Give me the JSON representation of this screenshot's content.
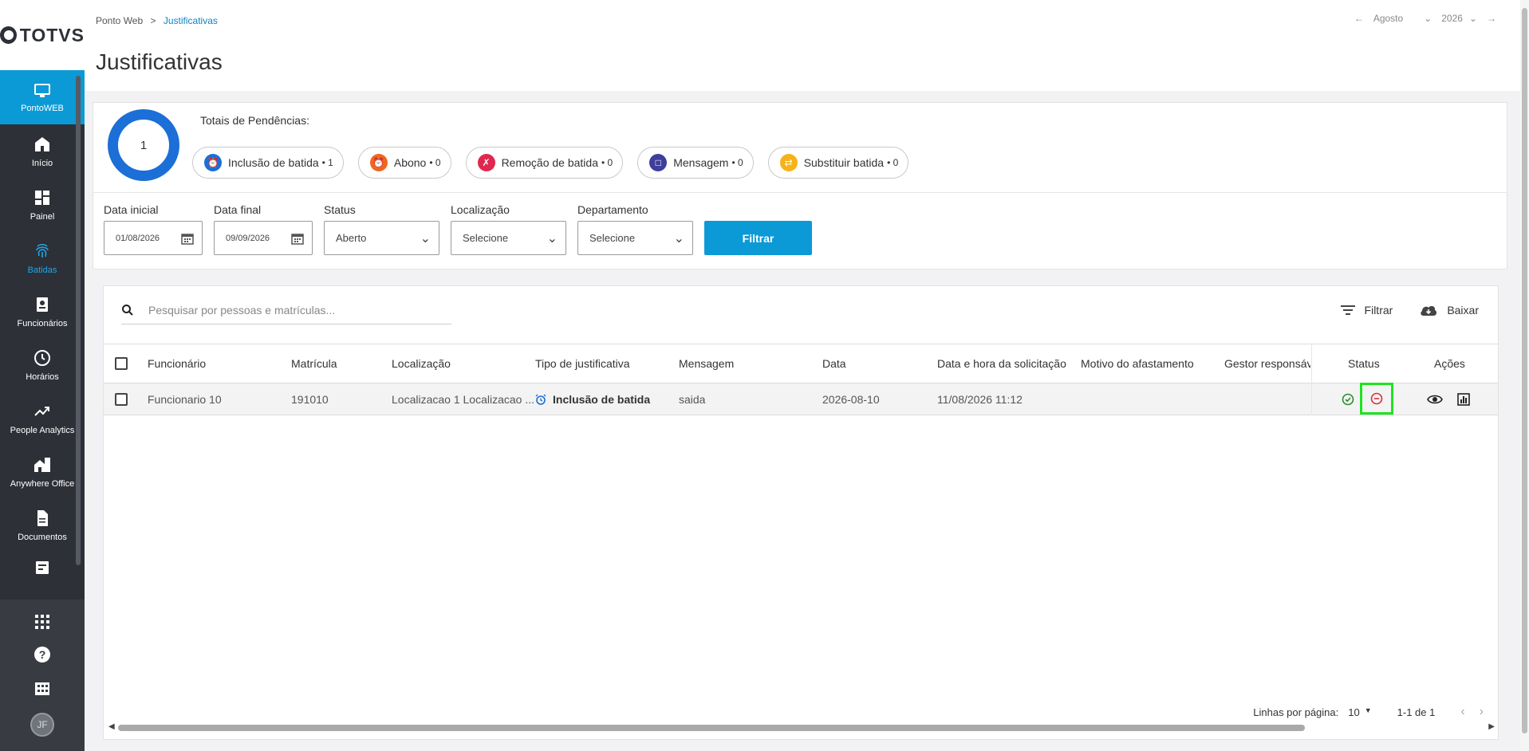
{
  "brand": {
    "name": "TOTVS"
  },
  "sidebar": {
    "active": {
      "label": "PontoWEB"
    },
    "items": [
      {
        "label": "Início",
        "icon": "home-icon"
      },
      {
        "label": "Painel",
        "icon": "dashboard-icon"
      },
      {
        "label": "Batidas",
        "icon": "fingerprint-icon"
      },
      {
        "label": "Funcionários",
        "icon": "badge-icon"
      },
      {
        "label": "Horários",
        "icon": "clock-icon"
      },
      {
        "label": "People Analytics",
        "icon": "trend-icon"
      },
      {
        "label": "Anywhere Office",
        "icon": "office-icon"
      },
      {
        "label": "Documentos",
        "icon": "document-icon"
      }
    ],
    "avatar_initials": "JF"
  },
  "header": {
    "breadcrumb": {
      "root": "Ponto Web",
      "separator": ">",
      "current": "Justificativas"
    },
    "title": "Justificativas",
    "period": {
      "month": "Agosto",
      "year": "2026"
    }
  },
  "summary": {
    "total": "1",
    "label": "Totais de Pendências:",
    "chips": [
      {
        "label": "Inclusão de batida",
        "count": "• 1",
        "color": "#1b6fd6"
      },
      {
        "label": "Abono",
        "count": "• 0",
        "color": "#f0651f"
      },
      {
        "label": "Remoção de batida",
        "count": "• 0",
        "color": "#e0274f"
      },
      {
        "label": "Mensagem",
        "count": "• 0",
        "color": "#3e3f9a"
      },
      {
        "label": "Substituir batida",
        "count": "• 0",
        "color": "#f6b21a"
      }
    ]
  },
  "filters": {
    "data_inicial": {
      "label": "Data inicial",
      "value": "01/08/2026"
    },
    "data_final": {
      "label": "Data final",
      "value": "09/09/2026"
    },
    "status": {
      "label": "Status",
      "value": "Aberto"
    },
    "localizacao": {
      "label": "Localização",
      "value": "Selecione"
    },
    "departamento": {
      "label": "Departamento",
      "value": "Selecione"
    },
    "button": "Filtrar"
  },
  "table": {
    "search_placeholder": "Pesquisar por pessoas e matrículas...",
    "filter_label": "Filtrar",
    "download_label": "Baixar",
    "columns": {
      "funcionario": "Funcionário",
      "matricula": "Matrícula",
      "localizacao": "Localização",
      "tipo": "Tipo de justificativa",
      "mensagem": "Mensagem",
      "data": "Data",
      "data_hora": "Data e hora da solicitação",
      "motivo": "Motivo do afastamento",
      "gestor": "Gestor responsáve",
      "status": "Status",
      "acoes": "Ações"
    },
    "rows": [
      {
        "funcionario": "Funcionario 10",
        "matricula": "191010",
        "localizacao": "Localizacao 1 Localizacao ...",
        "tipo": "Inclusão de batida",
        "mensagem": "saida",
        "data": "2026-08-10",
        "data_hora": "11/08/2026 11:12",
        "motivo": "",
        "gestor": ""
      }
    ]
  },
  "pagination": {
    "rows_label": "Linhas por página:",
    "rows_value": "10",
    "range": "1-1 de 1"
  }
}
